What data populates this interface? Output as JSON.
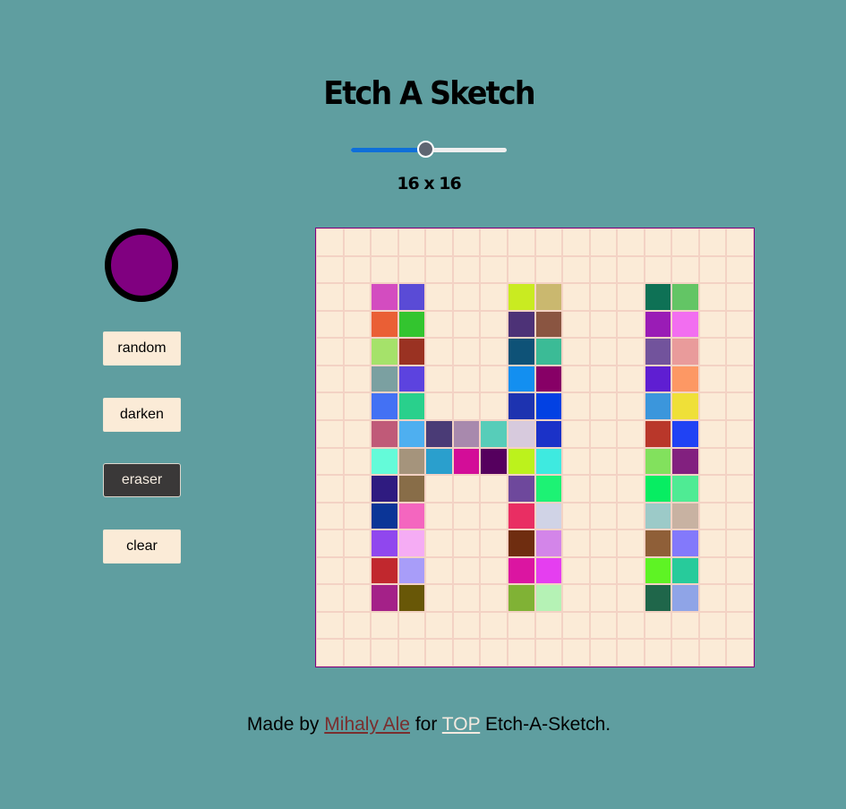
{
  "app": {
    "title": "Etch A Sketch"
  },
  "slider": {
    "value": 16,
    "min": 1,
    "max": 32,
    "label": "16 x 16",
    "track_fill_color": "#0f6fd9"
  },
  "color_picker": {
    "value": "#800080"
  },
  "controls": {
    "random_label": "random",
    "darken_label": "darken",
    "eraser_label": "eraser",
    "clear_label": "clear",
    "active_mode": "eraser"
  },
  "grid": {
    "size": 16,
    "background": "#fbebd7",
    "painted_cells": [
      {
        "row": 2,
        "col": 2,
        "color": "#d34cc0"
      },
      {
        "row": 2,
        "col": 3,
        "color": "#5a4bd6"
      },
      {
        "row": 3,
        "col": 2,
        "color": "#ea5f35"
      },
      {
        "row": 3,
        "col": 3,
        "color": "#33c52f"
      },
      {
        "row": 4,
        "col": 2,
        "color": "#a5e26a"
      },
      {
        "row": 4,
        "col": 3,
        "color": "#9a3222"
      },
      {
        "row": 5,
        "col": 2,
        "color": "#7ba0a1"
      },
      {
        "row": 5,
        "col": 3,
        "color": "#5c43df"
      },
      {
        "row": 6,
        "col": 2,
        "color": "#4371f4"
      },
      {
        "row": 6,
        "col": 3,
        "color": "#29d08c"
      },
      {
        "row": 7,
        "col": 2,
        "color": "#c05a78"
      },
      {
        "row": 7,
        "col": 3,
        "color": "#4eaff0"
      },
      {
        "row": 7,
        "col": 4,
        "color": "#4a3b76"
      },
      {
        "row": 7,
        "col": 5,
        "color": "#a889ad"
      },
      {
        "row": 7,
        "col": 6,
        "color": "#57cdb9"
      },
      {
        "row": 7,
        "col": 7,
        "color": "#d7cadd"
      },
      {
        "row": 7,
        "col": 8,
        "color": "#1b32c8"
      },
      {
        "row": 8,
        "col": 2,
        "color": "#64fbd9"
      },
      {
        "row": 8,
        "col": 3,
        "color": "#a5947c"
      },
      {
        "row": 8,
        "col": 4,
        "color": "#2a9fcd"
      },
      {
        "row": 8,
        "col": 5,
        "color": "#d30d98"
      },
      {
        "row": 8,
        "col": 6,
        "color": "#55005e"
      },
      {
        "row": 8,
        "col": 7,
        "color": "#bcf21c"
      },
      {
        "row": 8,
        "col": 8,
        "color": "#3eeae0"
      },
      {
        "row": 9,
        "col": 2,
        "color": "#2f1b80"
      },
      {
        "row": 9,
        "col": 3,
        "color": "#886d48"
      },
      {
        "row": 10,
        "col": 2,
        "color": "#0b3597"
      },
      {
        "row": 10,
        "col": 3,
        "color": "#f466bf"
      },
      {
        "row": 11,
        "col": 2,
        "color": "#9047ee"
      },
      {
        "row": 11,
        "col": 3,
        "color": "#f5acf4"
      },
      {
        "row": 12,
        "col": 2,
        "color": "#c1282e"
      },
      {
        "row": 12,
        "col": 3,
        "color": "#a89df9"
      },
      {
        "row": 13,
        "col": 2,
        "color": "#a42188"
      },
      {
        "row": 13,
        "col": 3,
        "color": "#685707"
      },
      {
        "row": 2,
        "col": 7,
        "color": "#c9eb21"
      },
      {
        "row": 2,
        "col": 8,
        "color": "#cab86f"
      },
      {
        "row": 3,
        "col": 7,
        "color": "#4d3277"
      },
      {
        "row": 3,
        "col": 8,
        "color": "#8a5541"
      },
      {
        "row": 4,
        "col": 7,
        "color": "#0e5277"
      },
      {
        "row": 4,
        "col": 8,
        "color": "#3bbb96"
      },
      {
        "row": 5,
        "col": 7,
        "color": "#138ff0"
      },
      {
        "row": 5,
        "col": 8,
        "color": "#870066"
      },
      {
        "row": 6,
        "col": 7,
        "color": "#1d33b0"
      },
      {
        "row": 6,
        "col": 8,
        "color": "#0241e3"
      },
      {
        "row": 9,
        "col": 7,
        "color": "#6e489c"
      },
      {
        "row": 9,
        "col": 8,
        "color": "#1df274"
      },
      {
        "row": 10,
        "col": 7,
        "color": "#e92e63"
      },
      {
        "row": 10,
        "col": 8,
        "color": "#d0d3e6"
      },
      {
        "row": 11,
        "col": 7,
        "color": "#6f2d10"
      },
      {
        "row": 11,
        "col": 8,
        "color": "#d385e9"
      },
      {
        "row": 12,
        "col": 7,
        "color": "#db15a1"
      },
      {
        "row": 12,
        "col": 8,
        "color": "#e53ef0"
      },
      {
        "row": 13,
        "col": 7,
        "color": "#80b235"
      },
      {
        "row": 13,
        "col": 8,
        "color": "#b5f2b5"
      },
      {
        "row": 2,
        "col": 12,
        "color": "#0e7155"
      },
      {
        "row": 2,
        "col": 13,
        "color": "#63c565"
      },
      {
        "row": 3,
        "col": 12,
        "color": "#9a1cb6"
      },
      {
        "row": 3,
        "col": 13,
        "color": "#f26ef0"
      },
      {
        "row": 4,
        "col": 12,
        "color": "#72539c"
      },
      {
        "row": 4,
        "col": 13,
        "color": "#e99b9b"
      },
      {
        "row": 5,
        "col": 12,
        "color": "#5f1ed2"
      },
      {
        "row": 5,
        "col": 13,
        "color": "#fd9864"
      },
      {
        "row": 6,
        "col": 12,
        "color": "#3b96dc"
      },
      {
        "row": 6,
        "col": 13,
        "color": "#efe038"
      },
      {
        "row": 7,
        "col": 12,
        "color": "#b9372a"
      },
      {
        "row": 7,
        "col": 13,
        "color": "#2042f4"
      },
      {
        "row": 8,
        "col": 12,
        "color": "#82e15d"
      },
      {
        "row": 8,
        "col": 13,
        "color": "#82207f"
      },
      {
        "row": 9,
        "col": 12,
        "color": "#07ed62"
      },
      {
        "row": 9,
        "col": 13,
        "color": "#4feb94"
      },
      {
        "row": 10,
        "col": 12,
        "color": "#9ccac8"
      },
      {
        "row": 10,
        "col": 13,
        "color": "#c8b2a2"
      },
      {
        "row": 11,
        "col": 12,
        "color": "#8f5f38"
      },
      {
        "row": 11,
        "col": 13,
        "color": "#8379fb"
      },
      {
        "row": 12,
        "col": 12,
        "color": "#5ef324"
      },
      {
        "row": 12,
        "col": 13,
        "color": "#27cb9b"
      },
      {
        "row": 13,
        "col": 12,
        "color": "#1f664a"
      },
      {
        "row": 13,
        "col": 13,
        "color": "#8fa4e7"
      }
    ]
  },
  "footer": {
    "prefix": "Made by ",
    "author": "Mihaly Ale",
    "middle": " for ",
    "top_link": "TOP",
    "suffix": " Etch-A-Sketch."
  }
}
